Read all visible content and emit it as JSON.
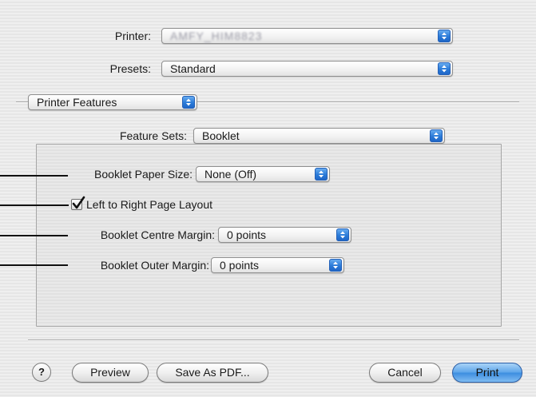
{
  "printer": {
    "label": "Printer:",
    "value": "AMFY_HIM8823"
  },
  "presets": {
    "label": "Presets:",
    "value": "Standard"
  },
  "panel_select": {
    "value": "Printer Features"
  },
  "feature_sets": {
    "label": "Feature Sets:",
    "value": "Booklet"
  },
  "booklet": {
    "paper_size": {
      "label": "Booklet Paper Size:",
      "value": "None (Off)"
    },
    "layout_checkbox": {
      "label": "Left to Right Page Layout",
      "checked": true
    },
    "centre_margin": {
      "label": "Booklet Centre Margin:",
      "value": "0 points"
    },
    "outer_margin": {
      "label": "Booklet Outer Margin:",
      "value": "0 points"
    }
  },
  "footer": {
    "help_label": "?",
    "preview_label": "Preview",
    "save_pdf_label": "Save As PDF...",
    "cancel_label": "Cancel",
    "print_label": "Print"
  },
  "colors": {
    "accent_blue": "#3c8de0",
    "callout_line": "#111111"
  }
}
